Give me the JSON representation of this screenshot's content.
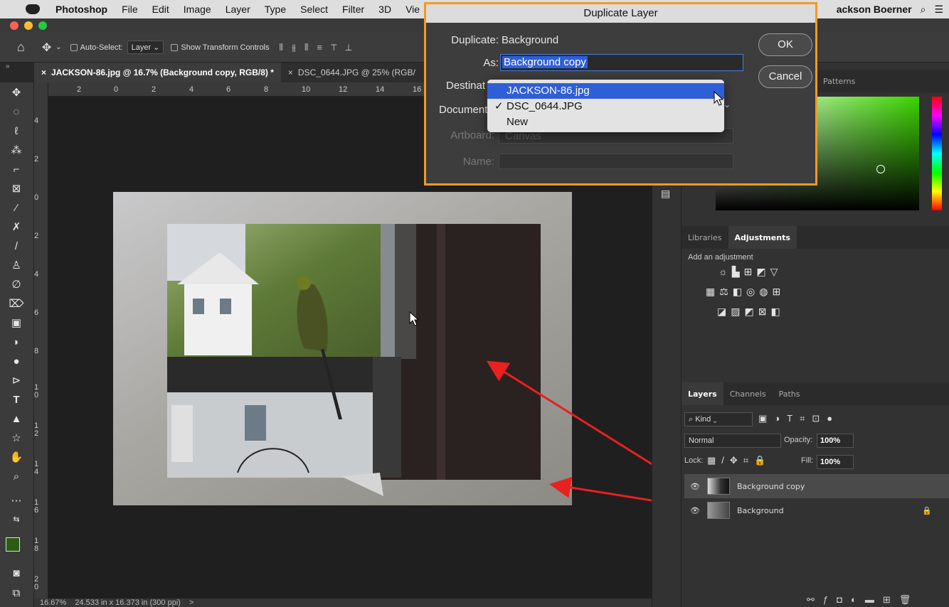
{
  "menubar": {
    "app_name": "Photoshop",
    "items": [
      "File",
      "Edit",
      "Image",
      "Layer",
      "Type",
      "Select",
      "Filter",
      "3D",
      "Vie"
    ],
    "user": "ackson Boerner"
  },
  "options": {
    "auto_select_label": "Auto-Select:",
    "auto_select_value": "Layer",
    "show_transform_label": "Show Transform Controls"
  },
  "tabs": [
    {
      "label": "JACKSON-86.jpg @ 16.7% (Background copy, RGB/8) *"
    },
    {
      "label": "DSC_0644.JPG @ 25% (RGB/"
    }
  ],
  "ruler": {
    "h": [
      "2",
      "0",
      "2",
      "4",
      "6",
      "8",
      "10",
      "12",
      "14",
      "16"
    ],
    "v": [
      "4",
      "2",
      "0",
      "2",
      "4",
      "6",
      "8",
      "1\n0",
      "1\n2",
      "1\n4",
      "1\n6",
      "1\n8",
      "2\n0"
    ]
  },
  "status": {
    "zoom": "16.67%",
    "size": "24.533 in x 16.373 in (300 ppi)",
    "arrow": ">"
  },
  "panels": {
    "color_tab": "Patterns",
    "lib_tabs": [
      "Libraries",
      "Adjustments"
    ],
    "add_adjustment": "Add an adjustment",
    "layer_tabs": [
      "Layers",
      "Channels",
      "Paths"
    ],
    "kind": "Kind",
    "blend_mode": "Normal",
    "opacity_label": "Opacity:",
    "opacity_value": "100%",
    "lock_label": "Lock:",
    "fill_label": "Fill:",
    "fill_value": "100%"
  },
  "layers": [
    {
      "name": "Background copy",
      "selected": true
    },
    {
      "name": "Background",
      "selected": false
    }
  ],
  "dialog": {
    "title": "Duplicate Layer",
    "duplicate_label": "Duplicate:",
    "duplicate_value": "Background",
    "as_label": "As:",
    "as_value": "Background copy",
    "destination_label": "Destinat",
    "document_label": "Document",
    "artboard_label": "Artboard:",
    "artboard_value": "Canvas",
    "name_label": "Name:",
    "ok": "OK",
    "cancel": "Cancel"
  },
  "document_menu": {
    "options": [
      "JACKSON-86.jpg",
      "DSC_0644.JPG",
      "New"
    ],
    "highlighted": "JACKSON-86.jpg",
    "checked": "DSC_0644.JPG"
  },
  "colors": {
    "highlight": "#2f5fd7",
    "dialog_border": "#f29a1f",
    "arrow_red": "#e82020",
    "arrow_orange": "#f29a1f",
    "foreground": "#2a5c14",
    "background": "#c9720e"
  }
}
